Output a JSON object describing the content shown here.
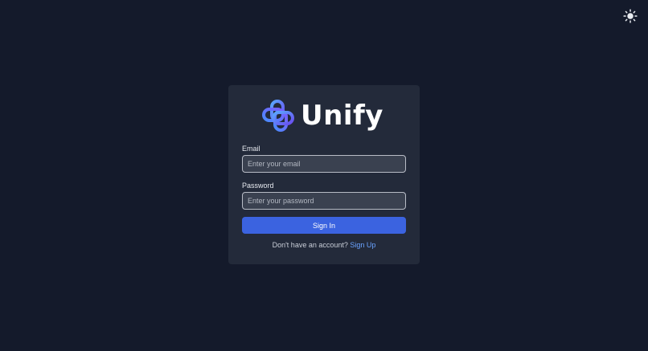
{
  "theme_toggle": {
    "icon": "sun-icon"
  },
  "brand": {
    "name": "Unify",
    "logo_icon": "interlocking-rings-logo"
  },
  "form": {
    "email_label": "Email",
    "email_placeholder": "Enter your email",
    "email_value": "",
    "password_label": "Password",
    "password_placeholder": "Enter your password",
    "password_value": "",
    "submit_label": "Sign In"
  },
  "signup": {
    "prompt": "Don't have an account?",
    "link_label": "Sign Up"
  },
  "colors": {
    "background": "#141a2b",
    "card": "#232a3a",
    "accent": "#3b63e0",
    "link": "#6aa3ff"
  }
}
